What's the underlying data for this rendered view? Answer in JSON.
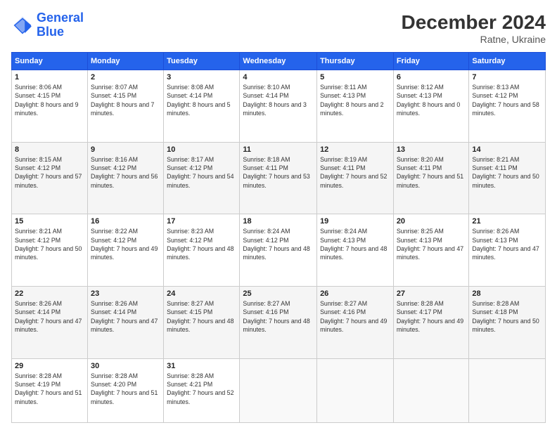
{
  "header": {
    "logo_line1": "General",
    "logo_line2": "Blue",
    "month_title": "December 2024",
    "subtitle": "Ratne, Ukraine"
  },
  "days_of_week": [
    "Sunday",
    "Monday",
    "Tuesday",
    "Wednesday",
    "Thursday",
    "Friday",
    "Saturday"
  ],
  "weeks": [
    [
      {
        "day": "1",
        "sunrise": "8:06 AM",
        "sunset": "4:15 PM",
        "daylight": "8 hours and 9 minutes."
      },
      {
        "day": "2",
        "sunrise": "8:07 AM",
        "sunset": "4:15 PM",
        "daylight": "8 hours and 7 minutes."
      },
      {
        "day": "3",
        "sunrise": "8:08 AM",
        "sunset": "4:14 PM",
        "daylight": "8 hours and 5 minutes."
      },
      {
        "day": "4",
        "sunrise": "8:10 AM",
        "sunset": "4:14 PM",
        "daylight": "8 hours and 3 minutes."
      },
      {
        "day": "5",
        "sunrise": "8:11 AM",
        "sunset": "4:13 PM",
        "daylight": "8 hours and 2 minutes."
      },
      {
        "day": "6",
        "sunrise": "8:12 AM",
        "sunset": "4:13 PM",
        "daylight": "8 hours and 0 minutes."
      },
      {
        "day": "7",
        "sunrise": "8:13 AM",
        "sunset": "4:12 PM",
        "daylight": "7 hours and 58 minutes."
      }
    ],
    [
      {
        "day": "8",
        "sunrise": "8:15 AM",
        "sunset": "4:12 PM",
        "daylight": "7 hours and 57 minutes."
      },
      {
        "day": "9",
        "sunrise": "8:16 AM",
        "sunset": "4:12 PM",
        "daylight": "7 hours and 56 minutes."
      },
      {
        "day": "10",
        "sunrise": "8:17 AM",
        "sunset": "4:12 PM",
        "daylight": "7 hours and 54 minutes."
      },
      {
        "day": "11",
        "sunrise": "8:18 AM",
        "sunset": "4:11 PM",
        "daylight": "7 hours and 53 minutes."
      },
      {
        "day": "12",
        "sunrise": "8:19 AM",
        "sunset": "4:11 PM",
        "daylight": "7 hours and 52 minutes."
      },
      {
        "day": "13",
        "sunrise": "8:20 AM",
        "sunset": "4:11 PM",
        "daylight": "7 hours and 51 minutes."
      },
      {
        "day": "14",
        "sunrise": "8:21 AM",
        "sunset": "4:11 PM",
        "daylight": "7 hours and 50 minutes."
      }
    ],
    [
      {
        "day": "15",
        "sunrise": "8:21 AM",
        "sunset": "4:12 PM",
        "daylight": "7 hours and 50 minutes."
      },
      {
        "day": "16",
        "sunrise": "8:22 AM",
        "sunset": "4:12 PM",
        "daylight": "7 hours and 49 minutes."
      },
      {
        "day": "17",
        "sunrise": "8:23 AM",
        "sunset": "4:12 PM",
        "daylight": "7 hours and 48 minutes."
      },
      {
        "day": "18",
        "sunrise": "8:24 AM",
        "sunset": "4:12 PM",
        "daylight": "7 hours and 48 minutes."
      },
      {
        "day": "19",
        "sunrise": "8:24 AM",
        "sunset": "4:13 PM",
        "daylight": "7 hours and 48 minutes."
      },
      {
        "day": "20",
        "sunrise": "8:25 AM",
        "sunset": "4:13 PM",
        "daylight": "7 hours and 47 minutes."
      },
      {
        "day": "21",
        "sunrise": "8:26 AM",
        "sunset": "4:13 PM",
        "daylight": "7 hours and 47 minutes."
      }
    ],
    [
      {
        "day": "22",
        "sunrise": "8:26 AM",
        "sunset": "4:14 PM",
        "daylight": "7 hours and 47 minutes."
      },
      {
        "day": "23",
        "sunrise": "8:26 AM",
        "sunset": "4:14 PM",
        "daylight": "7 hours and 47 minutes."
      },
      {
        "day": "24",
        "sunrise": "8:27 AM",
        "sunset": "4:15 PM",
        "daylight": "7 hours and 48 minutes."
      },
      {
        "day": "25",
        "sunrise": "8:27 AM",
        "sunset": "4:16 PM",
        "daylight": "7 hours and 48 minutes."
      },
      {
        "day": "26",
        "sunrise": "8:27 AM",
        "sunset": "4:16 PM",
        "daylight": "7 hours and 49 minutes."
      },
      {
        "day": "27",
        "sunrise": "8:28 AM",
        "sunset": "4:17 PM",
        "daylight": "7 hours and 49 minutes."
      },
      {
        "day": "28",
        "sunrise": "8:28 AM",
        "sunset": "4:18 PM",
        "daylight": "7 hours and 50 minutes."
      }
    ],
    [
      {
        "day": "29",
        "sunrise": "8:28 AM",
        "sunset": "4:19 PM",
        "daylight": "7 hours and 51 minutes."
      },
      {
        "day": "30",
        "sunrise": "8:28 AM",
        "sunset": "4:20 PM",
        "daylight": "7 hours and 51 minutes."
      },
      {
        "day": "31",
        "sunrise": "8:28 AM",
        "sunset": "4:21 PM",
        "daylight": "7 hours and 52 minutes."
      },
      null,
      null,
      null,
      null
    ]
  ]
}
